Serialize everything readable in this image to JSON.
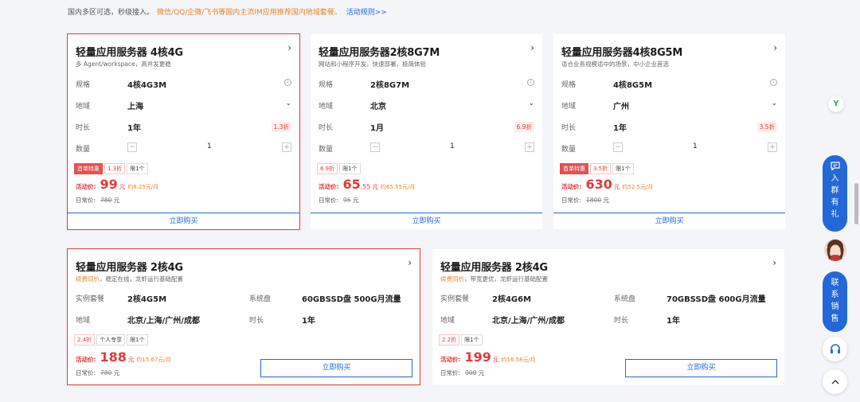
{
  "promo": {
    "text1": "国内多区可选，秒级接入。",
    "text2": "微信/QQ/企微/飞书等国内主流IM应用推荐国内地域套餐。",
    "link": "活动规则>>"
  },
  "labels": {
    "spec": "规格",
    "region": "地域",
    "duration": "时长",
    "quantity": "数量",
    "price": "活动价:",
    "orig": "日常价:",
    "yuan": "元",
    "buy": "立即购买",
    "package": "实例套餐",
    "disk": "系统盘"
  },
  "top_cards": [
    {
      "title": "轻量应用服务器 4核4G",
      "subtitle": "多 Agent/workspace，高并发更稳",
      "spec": "4核4G3M",
      "region": "上海",
      "duration": "1年",
      "discount": "1.3折",
      "quantity": "1",
      "tags": [
        "首单特惠",
        "1.3折",
        "限1个"
      ],
      "price_int": "99",
      "price_dec": "",
      "monthly": "约8.25元/月",
      "orig_price": "780",
      "selected": true
    },
    {
      "title": "轻量应用服务器2核8G7M",
      "subtitle": "网站和小程序开发，快速部署，极简体验",
      "spec": "2核8G7M",
      "region": "北京",
      "duration": "1月",
      "discount": "6.9折",
      "quantity": "1",
      "tags": [
        "6.9折",
        "限1个"
      ],
      "price_int": "65",
      "price_dec": ".55",
      "monthly": "约65.55元/月",
      "orig_price": "95",
      "selected": false
    },
    {
      "title": "轻量应用服务器4核8G5M",
      "subtitle": "适合业务规模适中的场景，中小企业首选",
      "spec": "4核8G5M",
      "region": "广州",
      "duration": "1年",
      "discount": "3.5折",
      "quantity": "1",
      "tags": [
        "首单特惠",
        "3.5折",
        "限1个"
      ],
      "price_int": "630",
      "price_dec": "",
      "monthly": "约52.5元/月",
      "orig_price": "1800",
      "selected": false
    }
  ],
  "bottom_cards": [
    {
      "title": "轻量应用服务器 2核4G",
      "subtitle_hl": "续费同价",
      "subtitle": "，稳定在线，龙虾运行基础配置",
      "package": "2核4G5M",
      "disk": "60GBSSD盘 500G月流量",
      "region": "北京/上海/广州/成都",
      "duration": "1年",
      "tags": [
        "2.4折",
        "个人专享",
        "限1个"
      ],
      "price_int": "188",
      "monthly": "约15.67元/月",
      "orig_price": "780",
      "selected": true
    },
    {
      "title": "轻量应用服务器 2核4G",
      "subtitle_hl": "续费同价",
      "subtitle": "，带宽更优，龙虾运行基础配置",
      "package": "2核4G6M",
      "disk": "70GBSSD盘 600G月流量",
      "region": "北京/上海/广州/成都",
      "duration": "1年",
      "tags": [
        "2.2折",
        "限1个"
      ],
      "price_int": "199",
      "monthly": "约16.58元/月",
      "orig_price": "900",
      "selected": false
    }
  ],
  "side": {
    "logo": "Y",
    "join_group": "入群有礼",
    "contact_sales": "联系销售"
  },
  "colors": {
    "accent": "#2468d8",
    "price_red": "#e23a3a",
    "promo_orange": "#e8852a"
  }
}
